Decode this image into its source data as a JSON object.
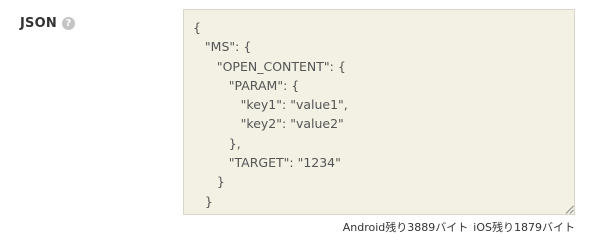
{
  "field": {
    "label": "JSON",
    "help_icon_glyph": "?",
    "value": "{\n   \"MS\": {\n      \"OPEN_CONTENT\": {\n         \"PARAM\": {\n            \"key1\": \"value1\",\n            \"key2\": \"value2\"\n         },\n         \"TARGET\": \"1234\"\n      }\n   }\n}"
  },
  "counter": {
    "android": "Android残り3889バイト",
    "ios": "iOS残り1879バイト"
  },
  "icons": {
    "help": "help-icon",
    "resize": "resize-grip-icon"
  },
  "colors": {
    "textarea_bg": "#f2f1e4",
    "textarea_border": "#d8d7c9",
    "help_icon_bg": "#c4c4c4"
  }
}
